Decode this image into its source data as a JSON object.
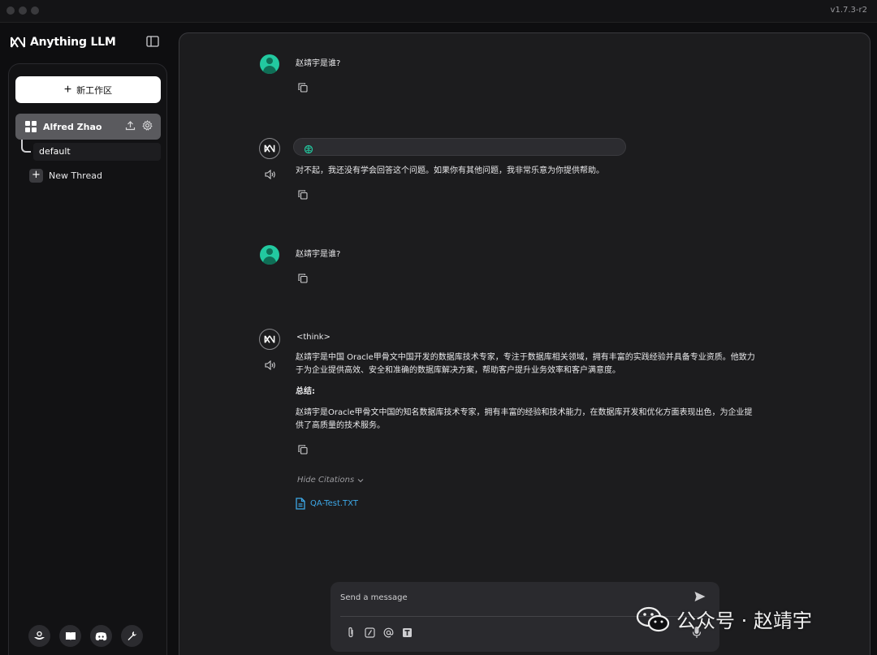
{
  "app": {
    "name": "Anything LLM",
    "version": "v1.7.3-r2"
  },
  "sidebar": {
    "new_workspace_label": "新工作区",
    "workspace": {
      "name": "Alfred Zhao"
    },
    "threads": [
      {
        "label": "default"
      }
    ],
    "new_thread_label": "New Thread",
    "footer_icons": [
      "community-hub-icon",
      "docs-book-icon",
      "discord-icon",
      "settings-wrench-icon"
    ]
  },
  "chat": {
    "messages": [
      {
        "role": "user",
        "text": "赵靖宇是谁?"
      },
      {
        "role": "assistant",
        "text": "对不起，我还没有学会回答这个问题。如果你有其他问题，我非常乐意为你提供帮助。"
      },
      {
        "role": "user",
        "text": "赵靖宇是谁?"
      },
      {
        "role": "assistant",
        "think_tag": "<think>",
        "para1_line1": "赵靖宇是中国 Oracle甲骨文中国开发的数据库技术专家，专注于数据库相关领域，拥有丰富的实践经验并具备专业资质。他致力",
        "para1_line2": "于为企业提供高效、安全和准确的数据库解决方案，帮助客户提升业务效率和客户满意度。",
        "summary_label": "总结:",
        "para2_line1": "赵靖宇是Oracle甲骨文中国的知名数据库技术专家，拥有丰富的经验和技术能力，在数据库开发和优化方面表现出色，为企业提",
        "para2_line2": "供了高质量的技术服务。"
      }
    ],
    "citations": {
      "toggle_label": "Hide Citations",
      "files": [
        "QA-Test.TXT"
      ]
    }
  },
  "composer": {
    "placeholder": "Send a message"
  },
  "watermark": {
    "text": "公众号 · 赵靖宇"
  },
  "colors": {
    "accent_green": "#22c9a0",
    "link_blue": "#3da8e8",
    "panel_bg": "#1c1c1e"
  }
}
